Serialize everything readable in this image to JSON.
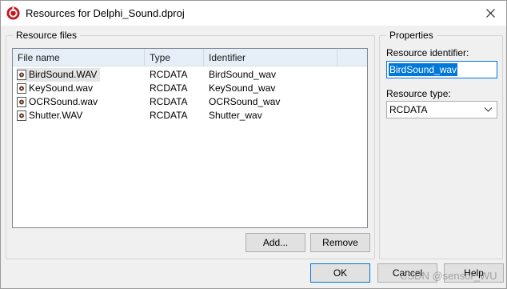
{
  "window": {
    "title": "Resources for Delphi_Sound.dproj",
    "icon": "delphi-app-icon",
    "close_icon": "close-icon"
  },
  "resource_files": {
    "legend": "Resource files",
    "columns": [
      "File name",
      "Type",
      "Identifier"
    ],
    "rows": [
      {
        "file": "BirdSound.WAV",
        "type": "RCDATA",
        "identifier": "BirdSound_wav",
        "selected": true
      },
      {
        "file": "KeySound.wav",
        "type": "RCDATA",
        "identifier": "KeySound_wav",
        "selected": false
      },
      {
        "file": "OCRSound.wav",
        "type": "RCDATA",
        "identifier": "OCRSound_wav",
        "selected": false
      },
      {
        "file": "Shutter.WAV",
        "type": "RCDATA",
        "identifier": "Shutter_wav",
        "selected": false
      }
    ],
    "add_label": "Add...",
    "remove_label": "Remove"
  },
  "properties": {
    "legend": "Properties",
    "identifier_label": "Resource identifier:",
    "identifier_value": "BirdSound_wav",
    "type_label": "Resource type:",
    "type_value": "RCDATA"
  },
  "footer": {
    "ok_label": "OK",
    "cancel_label": "Cancel",
    "help_label": "Help"
  },
  "watermark": "CSDN @sensor_WU",
  "colors": {
    "accent": "#0078d7",
    "header_bg": "#e6eff8",
    "dialog_bg": "#f0f0f0"
  }
}
